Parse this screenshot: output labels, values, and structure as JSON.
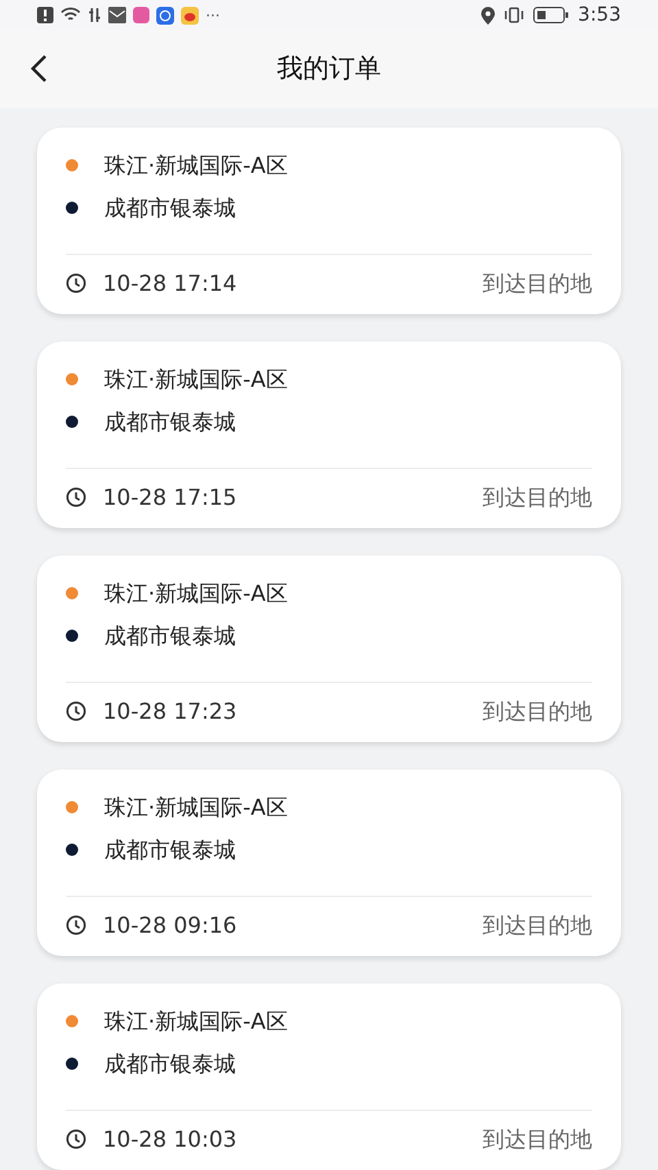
{
  "status_bar": {
    "more": "···",
    "time": "3:53"
  },
  "header": {
    "title": "我的订单"
  },
  "orders": [
    {
      "from": "珠江·新城国际-A区",
      "to": "成都市银泰城",
      "time": "10-28 17:14",
      "status": "到达目的地"
    },
    {
      "from": "珠江·新城国际-A区",
      "to": "成都市银泰城",
      "time": "10-28 17:15",
      "status": "到达目的地"
    },
    {
      "from": "珠江·新城国际-A区",
      "to": "成都市银泰城",
      "time": "10-28 17:23",
      "status": "到达目的地"
    },
    {
      "from": "珠江·新城国际-A区",
      "to": "成都市银泰城",
      "time": "10-28 09:16",
      "status": "到达目的地"
    },
    {
      "from": "珠江·新城国际-A区",
      "to": "成都市银泰城",
      "time": "10-28 10:03",
      "status": "到达目的地"
    }
  ]
}
